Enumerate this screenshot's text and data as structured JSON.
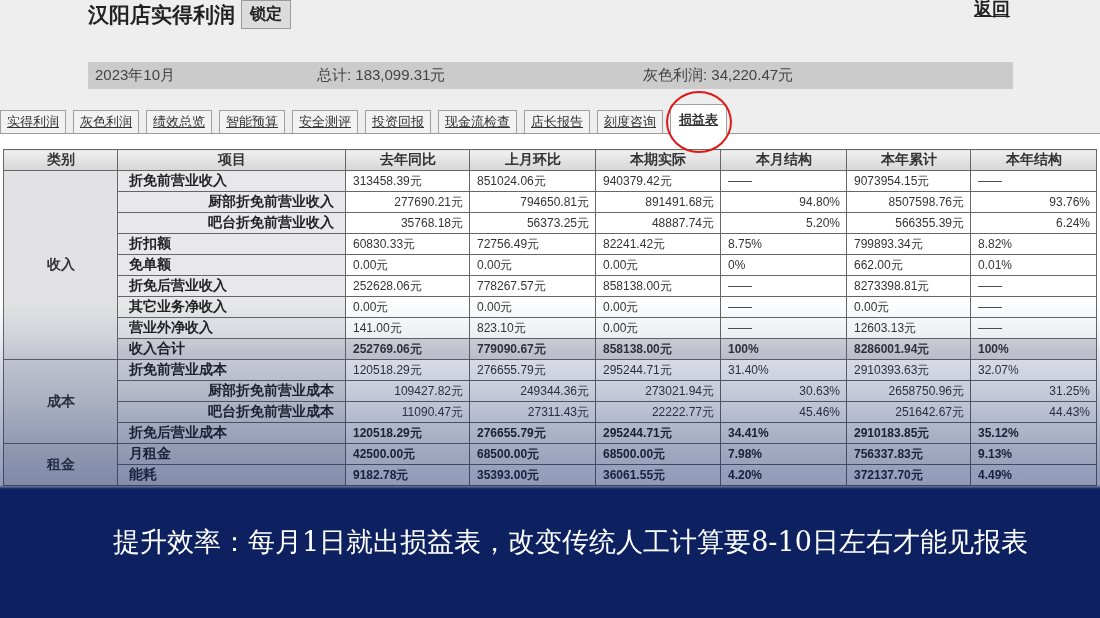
{
  "header": {
    "title": "汉阳店实得利润",
    "lock_button": "锁定",
    "back_link": "返回"
  },
  "summary": {
    "month": "2023年10月",
    "total": "总计: 183,099.31元",
    "gray_profit": "灰色利润: 34,220.47元"
  },
  "tabs": [
    {
      "label": "实得利润",
      "selected": false,
      "circled": false
    },
    {
      "label": "灰色利润",
      "selected": false,
      "circled": false
    },
    {
      "label": "绩效总览",
      "selected": false,
      "circled": false
    },
    {
      "label": "智能预算",
      "selected": false,
      "circled": false
    },
    {
      "label": "安全测评",
      "selected": false,
      "circled": false
    },
    {
      "label": "投资回报",
      "selected": false,
      "circled": false
    },
    {
      "label": "现金流检查",
      "selected": false,
      "circled": false
    },
    {
      "label": "店长报告",
      "selected": false,
      "circled": false
    },
    {
      "label": "刻度咨询",
      "selected": false,
      "circled": false
    },
    {
      "label": "损益表",
      "selected": true,
      "circled": true
    }
  ],
  "table": {
    "columns": [
      "类别",
      "项目",
      "去年同比",
      "上月环比",
      "本期实际",
      "本月结构",
      "本年累计",
      "本年结构"
    ],
    "groups": [
      {
        "category": "收入",
        "rows": [
          {
            "item": "折免前营业收入",
            "kind": "main",
            "values": [
              "313458.39元",
              "851024.06元",
              "940379.42元",
              "——",
              "9073954.15元",
              "——"
            ]
          },
          {
            "item": "厨部折免前营业收入",
            "kind": "sub",
            "values": [
              "277690.21元",
              "794650.81元",
              "891491.68元",
              "94.80%",
              "8507598.76元",
              "93.76%"
            ]
          },
          {
            "item": "吧台折免前营业收入",
            "kind": "sub",
            "values": [
              "35768.18元",
              "56373.25元",
              "48887.74元",
              "5.20%",
              "566355.39元",
              "6.24%"
            ]
          },
          {
            "item": "折扣额",
            "kind": "main",
            "values": [
              "60830.33元",
              "72756.49元",
              "82241.42元",
              "8.75%",
              "799893.34元",
              "8.82%"
            ]
          },
          {
            "item": "免单额",
            "kind": "main",
            "values": [
              "0.00元",
              "0.00元",
              "0.00元",
              "0%",
              "662.00元",
              "0.01%"
            ]
          },
          {
            "item": "折免后营业收入",
            "kind": "main",
            "values": [
              "252628.06元",
              "778267.57元",
              "858138.00元",
              "——",
              "8273398.81元",
              "——"
            ]
          },
          {
            "item": "其它业务净收入",
            "kind": "main",
            "values": [
              "0.00元",
              "0.00元",
              "0.00元",
              "——",
              "0.00元",
              "——"
            ]
          },
          {
            "item": "营业外净收入",
            "kind": "main",
            "values": [
              "141.00元",
              "823.10元",
              "0.00元",
              "——",
              "12603.13元",
              "——"
            ]
          },
          {
            "item": "收入合计",
            "kind": "total",
            "values": [
              "252769.06元",
              "779090.67元",
              "858138.00元",
              "100%",
              "8286001.94元",
              "100%"
            ]
          }
        ]
      },
      {
        "category": "成本",
        "rows": [
          {
            "item": "折免前营业成本",
            "kind": "main",
            "values": [
              "120518.29元",
              "276655.79元",
              "295244.71元",
              "31.40%",
              "2910393.63元",
              "32.07%"
            ]
          },
          {
            "item": "厨部折免前营业成本",
            "kind": "sub",
            "values": [
              "109427.82元",
              "249344.36元",
              "273021.94元",
              "30.63%",
              "2658750.96元",
              "31.25%"
            ]
          },
          {
            "item": "吧台折免前营业成本",
            "kind": "sub",
            "values": [
              "11090.47元",
              "27311.43元",
              "22222.77元",
              "45.46%",
              "251642.67元",
              "44.43%"
            ]
          },
          {
            "item": "折免后营业成本",
            "kind": "bold",
            "values": [
              "120518.29元",
              "276655.79元",
              "295244.71元",
              "34.41%",
              "2910183.85元",
              "35.12%"
            ]
          }
        ]
      },
      {
        "category": "租金",
        "rows": [
          {
            "item": "月租金",
            "kind": "bold",
            "values": [
              "42500.00元",
              "68500.00元",
              "68500.00元",
              "7.98%",
              "756337.83元",
              "9.13%"
            ]
          },
          {
            "item": "能耗",
            "kind": "bold",
            "values": [
              "9182.78元",
              "35393.00元",
              "36061.55元",
              "4.20%",
              "372137.70元",
              "4.49%"
            ]
          }
        ]
      }
    ]
  },
  "caption": "提升效率：每月1日就出损益表，改变传统人工计算要8-10日左右才能见报表"
}
